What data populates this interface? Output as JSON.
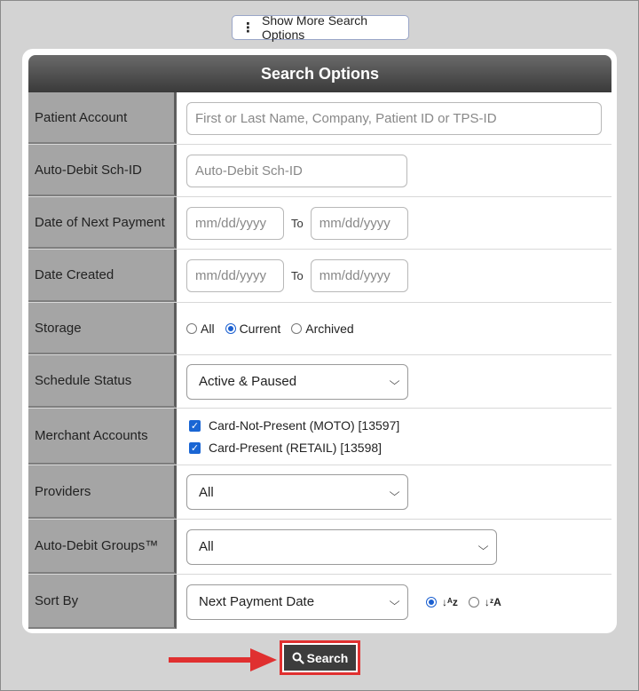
{
  "more_options_label": "Show More Search Options",
  "panel_title": "Search Options",
  "patient_account": {
    "label": "Patient Account",
    "placeholder": "First or Last Name, Company, Patient ID or TPS-ID"
  },
  "auto_debit_id": {
    "label": "Auto-Debit Sch-ID",
    "placeholder": "Auto-Debit Sch-ID"
  },
  "next_payment": {
    "label": "Date of Next Payment",
    "from_placeholder": "mm/dd/yyyy",
    "to_label": "To",
    "to_placeholder": "mm/dd/yyyy"
  },
  "date_created": {
    "label": "Date Created",
    "from_placeholder": "mm/dd/yyyy",
    "to_label": "To",
    "to_placeholder": "mm/dd/yyyy"
  },
  "storage": {
    "label": "Storage",
    "options": [
      "All",
      "Current",
      "Archived"
    ],
    "selected": "Current"
  },
  "schedule_status": {
    "label": "Schedule Status",
    "value": "Active & Paused"
  },
  "merchant_accounts": {
    "label": "Merchant Accounts",
    "items": [
      {
        "label": "Card-Not-Present (MOTO) [13597]",
        "checked": true
      },
      {
        "label": "Card-Present (RETAIL) [13598]",
        "checked": true
      }
    ]
  },
  "providers": {
    "label": "Providers",
    "value": "All"
  },
  "auto_debit_groups": {
    "label": "Auto-Debit Groups™",
    "value": "All"
  },
  "sort_by": {
    "label": "Sort By",
    "value": "Next Payment Date",
    "asc_icon": "sort-ascending-icon",
    "desc_icon": "sort-descending-icon",
    "selected": "ascending",
    "asc_glyph": "↓ᴬz",
    "desc_glyph": "↓ᶻA"
  },
  "search_button": "Search",
  "colors": {
    "header": "#3a3a3a",
    "label_bg": "#a5a5a5",
    "accent": "#1a66d4",
    "highlight": "#e03030"
  }
}
